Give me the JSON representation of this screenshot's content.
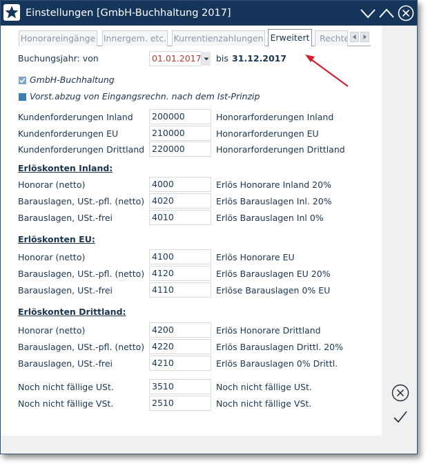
{
  "window": {
    "title": "Einstellungen [GmbH-Buchhaltung 2017]"
  },
  "tabs": [
    {
      "label": "Honorareingänge",
      "active": false
    },
    {
      "label": "Innergem. etc.",
      "active": false
    },
    {
      "label": "Kurrentienzahlungen",
      "active": false
    },
    {
      "label": "Erweitert",
      "active": true
    },
    {
      "label": "Rechte",
      "active": false
    }
  ],
  "booking_year": {
    "label_from": "Buchungsjahr: von",
    "from_value": "01.01.2017",
    "label_to": "bis",
    "to_value": "31.12.2017"
  },
  "checkboxes": [
    {
      "label": "GmbH-Buchhaltung",
      "checked": true
    },
    {
      "label": "Vorst.abzug von Eingangsrechn. nach dem Ist-Prinzip",
      "checked": false
    }
  ],
  "receivables": [
    {
      "label": "Kundenforderungen Inland",
      "value": "200000",
      "desc": "Honorarforderungen Inland"
    },
    {
      "label": "Kundenforderungen EU",
      "value": "210000",
      "desc": "Honorarforderungen EU"
    },
    {
      "label": "Kundenforderungen Drittland",
      "value": "220000",
      "desc": "Honorarforderungen Drittland"
    }
  ],
  "sections": [
    {
      "heading": "Erlöskonten Inland:",
      "rows": [
        {
          "label": "Honorar (netto)",
          "value": "4000",
          "desc": "Erlös Honorare Inland 20%"
        },
        {
          "label": "Barauslagen, USt.-pfl. (netto)",
          "value": "4020",
          "desc": "Erlös Barauslagen Inl. 20%"
        },
        {
          "label": "Barauslagen, USt.-frei",
          "value": "4010",
          "desc": "Erlös Barauslagen Inl 0%"
        }
      ]
    },
    {
      "heading": "Erlöskonten EU:",
      "rows": [
        {
          "label": "Honorar (netto)",
          "value": "4100",
          "desc": "Erlös Honorare EU"
        },
        {
          "label": "Barauslagen, USt.-pfl. (netto)",
          "value": "4120",
          "desc": "Erlös Barauslagen EU 20%"
        },
        {
          "label": "Barauslagen, USt.-frei",
          "value": "4110",
          "desc": "Erlöse Barauslagen 0% EU"
        }
      ]
    },
    {
      "heading": "Erlöskonten Drittland:",
      "rows": [
        {
          "label": "Honorar (netto)",
          "value": "4200",
          "desc": "Erlös Honorare Drittland"
        },
        {
          "label": "Barauslagen, USt.-pfl. (netto)",
          "value": "4220",
          "desc": "Erlös Barauslagen Drittl. 20%"
        },
        {
          "label": "Barauslagen, USt.-frei",
          "value": "4210",
          "desc": "Erlös Barauslagen 0% Drittl."
        }
      ]
    }
  ],
  "tax": [
    {
      "label": "Noch nicht fällige USt.",
      "value": "3510",
      "desc": "Noch nicht fällige USt."
    },
    {
      "label": "Noch nicht fällige VSt.",
      "value": "2510",
      "desc": "Noch nicht fällige VSt."
    }
  ],
  "icons": {
    "app": "star-icon",
    "minimize": "chevron-down-icon",
    "maximize": "chevron-up-icon",
    "close": "close-circle-icon",
    "cancel": "cancel-circle-icon",
    "confirm": "checkmark-icon",
    "annotation": "red-arrow-annotation"
  },
  "colors": {
    "titlebar": "#16355a",
    "accent": "#1a3550",
    "date_text": "#c0392b",
    "annotation_arrow": "#d0202a"
  }
}
